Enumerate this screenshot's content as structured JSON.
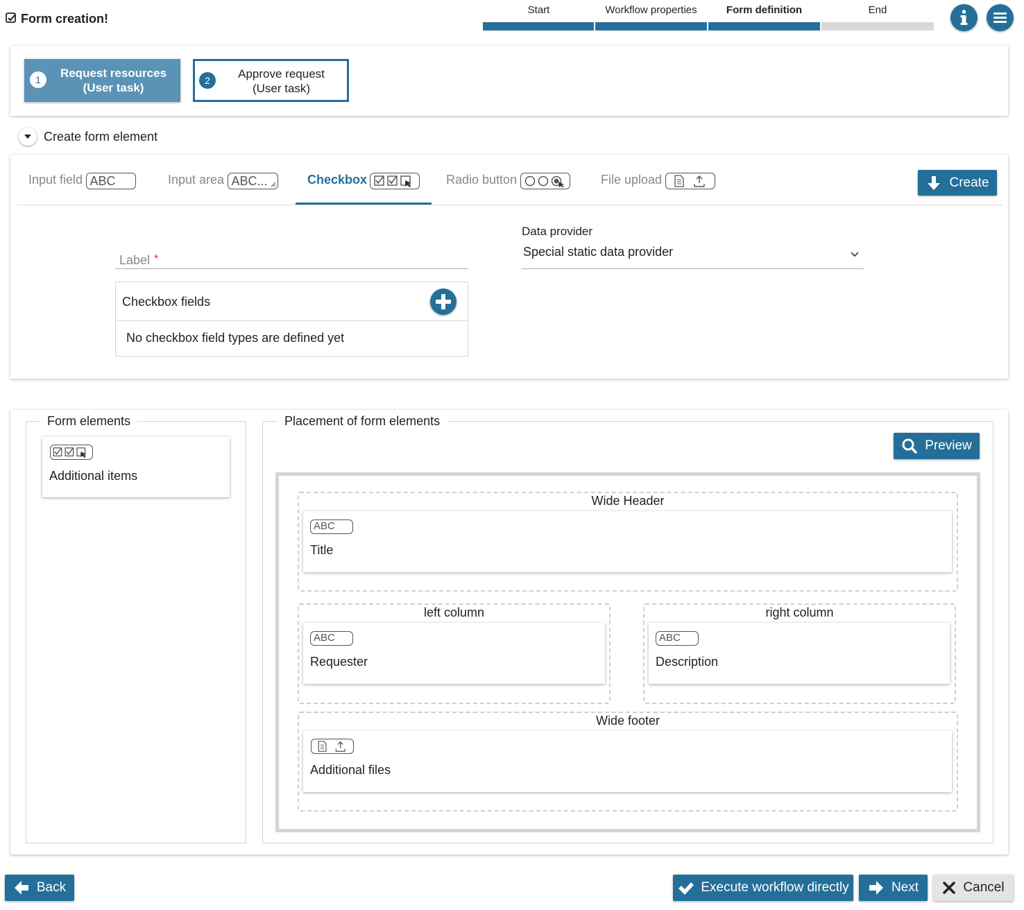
{
  "header": {
    "title": "Form creation!",
    "steps": [
      {
        "label": "Start",
        "state": "done"
      },
      {
        "label": "Workflow properties",
        "state": "done"
      },
      {
        "label": "Form definition",
        "state": "active"
      },
      {
        "label": "End",
        "state": "todo"
      }
    ],
    "info_icon": "info-icon",
    "menu_icon": "hamburger-menu-icon"
  },
  "tasks": [
    {
      "number": "1",
      "line1": "Request resources",
      "line2": "(User task)",
      "selected": true
    },
    {
      "number": "2",
      "line1": "Approve request",
      "line2": "(User task)",
      "selected": false
    }
  ],
  "create_section": {
    "toggle_label": "Create form element",
    "tabs": [
      {
        "label": "Input field",
        "icon_text": "ABC"
      },
      {
        "label": "Input area",
        "icon_text": "ABC..."
      },
      {
        "label": "Checkbox",
        "icon_text": ""
      },
      {
        "label": "Radio button",
        "icon_text": ""
      },
      {
        "label": "File upload",
        "icon_text": ""
      }
    ],
    "active_tab": "Checkbox",
    "create_button": "Create",
    "label_placeholder": "Label",
    "required_mark": "*",
    "data_provider_label": "Data provider",
    "data_provider_value": "Special static data provider",
    "checkbox_fields_title": "Checkbox fields",
    "checkbox_fields_empty": "No checkbox field types are defined yet"
  },
  "form_elements": {
    "title": "Form elements",
    "items": [
      {
        "label": "Additional items",
        "icon": "checkbox-group-icon"
      }
    ]
  },
  "placement": {
    "title": "Placement of form elements",
    "preview_button": "Preview",
    "zones": {
      "wide_header": {
        "title": "Wide Header",
        "item": {
          "label": "Title",
          "icon_text": "ABC"
        }
      },
      "left_column": {
        "title": "left column",
        "item": {
          "label": "Requester",
          "icon_text": "ABC"
        }
      },
      "right_column": {
        "title": "right column",
        "item": {
          "label": "Description",
          "icon_text": "ABC"
        }
      },
      "wide_footer": {
        "title": "Wide footer",
        "item": {
          "label": "Additional files",
          "icon": "file-upload-icon"
        }
      }
    }
  },
  "footer": {
    "back": "Back",
    "execute": "Execute workflow directly",
    "next": "Next",
    "cancel": "Cancel"
  },
  "colors": {
    "primary": "#236f99",
    "task_selected": "#5a93b5",
    "progress_todo": "#d9d9d9",
    "required": "#d32f2f"
  }
}
